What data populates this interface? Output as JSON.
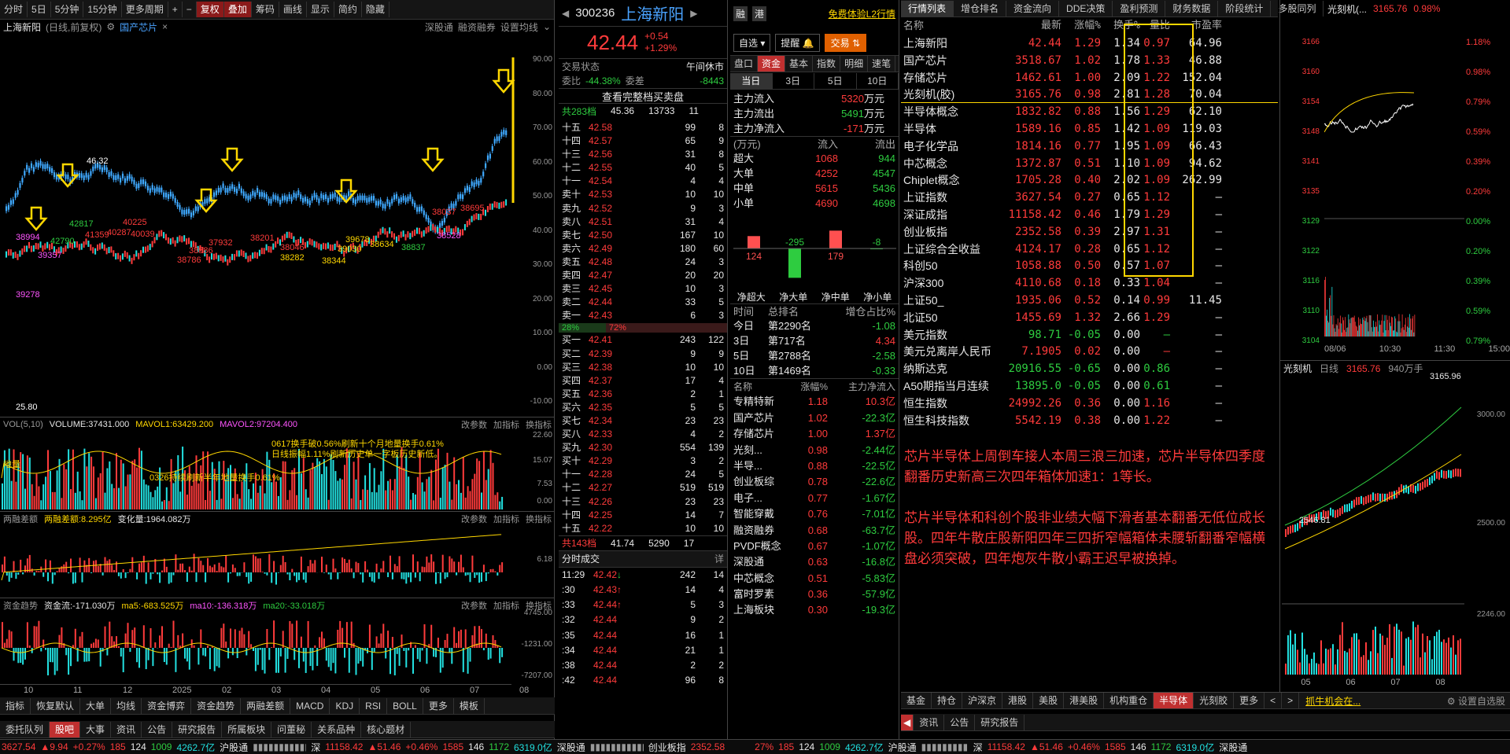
{
  "toolbar": {
    "buttons": [
      "分时",
      "5日",
      "5分钟",
      "15分钟",
      "更多周期",
      "复权",
      "叠加",
      "筹码",
      "画线",
      "显示",
      "简约",
      "隐藏"
    ]
  },
  "chart": {
    "title": "上海新阳",
    "subtitle": "(日线,前复权)",
    "overlay": "国产芯片",
    "links": [
      "深股通",
      "融资融券",
      "设置均线"
    ],
    "price_axis": [
      "90.00",
      "80.00",
      "70.00",
      "60.00",
      "50.00",
      "40.00",
      "30.00",
      "20.00",
      "10.00",
      "0.00",
      "-10.00"
    ],
    "date_axis": [
      "10",
      "11",
      "12",
      "2025",
      "02",
      "03",
      "04",
      "05",
      "06",
      "07",
      "08"
    ],
    "peak_label": "46.32",
    "low_label": "25.80",
    "overlay_labels": [
      {
        "t": "38994",
        "c": "mag"
      },
      {
        "t": "39357",
        "c": "mag"
      },
      {
        "t": "42790",
        "c": "grn"
      },
      {
        "t": "42817",
        "c": "grn"
      },
      {
        "t": "41359",
        "c": "red"
      },
      {
        "t": "40287",
        "c": "red"
      },
      {
        "t": "40225",
        "c": "red"
      },
      {
        "t": "40039",
        "c": "red"
      },
      {
        "t": "38786",
        "c": "red"
      },
      {
        "t": "38586",
        "c": "red"
      },
      {
        "t": "37932",
        "c": "red"
      },
      {
        "t": "38201",
        "c": "red"
      },
      {
        "t": "38046",
        "c": "red"
      },
      {
        "t": "38282",
        "c": "yel"
      },
      {
        "t": "38344",
        "c": "yel"
      },
      {
        "t": "39030",
        "c": "yel"
      },
      {
        "t": "39678",
        "c": "yel"
      },
      {
        "t": "38634",
        "c": "yel"
      },
      {
        "t": "38837",
        "c": "grn"
      },
      {
        "t": "38037",
        "c": "red"
      },
      {
        "t": "38695",
        "c": "red"
      },
      {
        "t": "38528",
        "c": "mag"
      },
      {
        "t": "39278",
        "c": "mag"
      }
    ]
  },
  "vol": {
    "header": "VOL(5,10)",
    "volume": "VOLUME:37431.000",
    "ma1": "MAVOL1:63429.200",
    "ma2": "MAVOL2:97204.400",
    "actions": [
      "改参数",
      "加指标",
      "换指标"
    ],
    "axis": [
      "22.60",
      "15.07",
      "7.53",
      "0.00"
    ],
    "note1": "0617换手破0.56%刷新十个月地量换手0.61%",
    "note2": "日线振幅1.11%刷新历史单一字板历史新低。",
    "note3": "0326持续刷新半年地量换手0.61%",
    "note4": "地量"
  },
  "margin": {
    "header": "两融差额",
    "value": "两融差额:8.295亿",
    "change": "变化量:1964.082万",
    "actions": [
      "改参数",
      "加指标",
      "换指标"
    ],
    "axis": [
      "6.18"
    ]
  },
  "flow": {
    "header": "资金趋势",
    "value": "资金流:-171.030万",
    "ma5": "ma5:-683.525万",
    "ma10": "ma10:-136.318万",
    "ma20": "ma20:-33.018万",
    "actions": [
      "改参数",
      "加指标",
      "换指标"
    ],
    "axis": [
      "4745.00",
      "-1231.00",
      "-7207.00"
    ]
  },
  "indicator_tabs": [
    "指标",
    "恢复默认",
    "大单",
    "均线",
    "资金博弈",
    "资金趋势",
    "两融差额",
    "MACD",
    "KDJ",
    "RSI",
    "BOLL",
    "更多",
    "模板"
  ],
  "bottom_left_tabs": [
    "委托队列",
    "股吧",
    "大事",
    "资讯",
    "公告",
    "研究报告",
    "所属板块",
    "问董秘",
    "关系品种",
    "核心题材"
  ],
  "status": {
    "sh_index": "3627.54",
    "sh_change": "9.94",
    "sh_pct": "+0.27%",
    "sh_up": "185",
    "sh_flat": "124",
    "sh_down": "1009",
    "sh_amt": "4262.7亿",
    "sh_conn": "沪股通",
    "sz_label": "深",
    "sz_index": "11158.42",
    "sz_change": "51.46",
    "sz_pct": "+0.46%",
    "sz_up": "1585",
    "sz_flat": "146",
    "sz_down": "1172",
    "sz_amt": "6319.0亿",
    "sz_conn": "深股通",
    "cy_label": "创业板指",
    "cy_index": "2352.58",
    "r_pct": "27%",
    "r_up": "185",
    "r_flat": "124",
    "r_down": "1009",
    "r_amt": "4262.7亿",
    "r_conn": "沪股通",
    "r_sz": "深",
    "r_szidx": "11158.42",
    "r_szchg": "51.46",
    "r_szpct": "+0.46%",
    "r_szup": "1585",
    "r_szflat": "146",
    "r_szdown": "1172",
    "r_szamt": "6319.0亿",
    "r_szconn": "深股通"
  },
  "stock": {
    "code": "300236",
    "name": "上海新阳",
    "tags": [
      "融",
      "港"
    ],
    "l2": "免费体验L2行情",
    "price": "42.44",
    "change": "+0.54",
    "pct": "+1.29%",
    "select_btn": "自选",
    "alert_btn": "提醒",
    "trade_btn": "交易",
    "trade_status_label": "交易状态",
    "trade_status": "午间休市",
    "wb_label": "委比",
    "wb": "-44.38%",
    "wc_label": "委差",
    "wc": "-8443",
    "full_book": "查看完整档买卖盘",
    "total_sell": "共283档",
    "total_sell_p": "45.36",
    "total_sell_v": "13733",
    "total_sell_n": "11",
    "sell_pct": "28%",
    "buy_pct": "72%",
    "total_buy": "共143档",
    "total_buy_p": "41.74",
    "total_buy_v": "5290",
    "total_buy_n": "17"
  },
  "sells": [
    {
      "l": "十五",
      "p": "42.58",
      "v": "99",
      "n": "8"
    },
    {
      "l": "十四",
      "p": "42.57",
      "v": "65",
      "n": "9"
    },
    {
      "l": "十三",
      "p": "42.56",
      "v": "31",
      "n": "8"
    },
    {
      "l": "十二",
      "p": "42.55",
      "v": "40",
      "n": "5"
    },
    {
      "l": "十一",
      "p": "42.54",
      "v": "4",
      "n": "4"
    },
    {
      "l": "卖十",
      "p": "42.53",
      "v": "10",
      "n": "10"
    },
    {
      "l": "卖九",
      "p": "42.52",
      "v": "9",
      "n": "3"
    },
    {
      "l": "卖八",
      "p": "42.51",
      "v": "31",
      "n": "4"
    },
    {
      "l": "卖七",
      "p": "42.50",
      "v": "167",
      "n": "10"
    },
    {
      "l": "卖六",
      "p": "42.49",
      "v": "180",
      "n": "60"
    },
    {
      "l": "卖五",
      "p": "42.48",
      "v": "24",
      "n": "3"
    },
    {
      "l": "卖四",
      "p": "42.47",
      "v": "20",
      "n": "20"
    },
    {
      "l": "卖三",
      "p": "42.45",
      "v": "10",
      "n": "3"
    },
    {
      "l": "卖二",
      "p": "42.44",
      "v": "33",
      "n": "5"
    },
    {
      "l": "卖一",
      "p": "42.43",
      "v": "6",
      "n": "3"
    }
  ],
  "buys": [
    {
      "l": "买一",
      "p": "42.41",
      "v": "243",
      "n": "122"
    },
    {
      "l": "买二",
      "p": "42.39",
      "v": "9",
      "n": "9"
    },
    {
      "l": "买三",
      "p": "42.38",
      "v": "10",
      "n": "10"
    },
    {
      "l": "买四",
      "p": "42.37",
      "v": "17",
      "n": "4"
    },
    {
      "l": "买五",
      "p": "42.36",
      "v": "2",
      "n": "1"
    },
    {
      "l": "买六",
      "p": "42.35",
      "v": "5",
      "n": "5"
    },
    {
      "l": "买七",
      "p": "42.34",
      "v": "23",
      "n": "23"
    },
    {
      "l": "买八",
      "p": "42.33",
      "v": "4",
      "n": "2"
    },
    {
      "l": "买九",
      "p": "42.30",
      "v": "554",
      "n": "139"
    },
    {
      "l": "买十",
      "p": "42.29",
      "v": "3",
      "n": "2"
    },
    {
      "l": "十一",
      "p": "42.28",
      "v": "24",
      "n": "5"
    },
    {
      "l": "十二",
      "p": "42.27",
      "v": "519",
      "n": "519"
    },
    {
      "l": "十三",
      "p": "42.26",
      "v": "23",
      "n": "23"
    },
    {
      "l": "十四",
      "p": "42.25",
      "v": "14",
      "n": "7"
    },
    {
      "l": "十五",
      "p": "42.22",
      "v": "10",
      "n": "10"
    }
  ],
  "ticks_header": "分时成交",
  "ticks_detail": "详",
  "ticks": [
    {
      "t": "11:29",
      "p": "42.42",
      "a": "↓",
      "v": "242",
      "n": "14"
    },
    {
      "t": ":30",
      "p": "42.43",
      "a": "↑",
      "v": "14",
      "n": "4"
    },
    {
      "t": ":33",
      "p": "42.44",
      "a": "↑",
      "v": "5",
      "n": "3"
    },
    {
      "t": ":32",
      "p": "42.44",
      "a": "",
      "v": "9",
      "n": "2"
    },
    {
      "t": ":35",
      "p": "42.44",
      "a": "",
      "v": "16",
      "n": "1"
    },
    {
      "t": ":34",
      "p": "42.44",
      "a": "",
      "v": "21",
      "n": "1"
    },
    {
      "t": ":38",
      "p": "42.44",
      "a": "",
      "v": "2",
      "n": "2"
    },
    {
      "t": ":42",
      "p": "42.44",
      "a": "",
      "v": "96",
      "n": "8"
    }
  ],
  "fund_tabs": [
    "盘口",
    "资金",
    "基本",
    "指数",
    "明细",
    "速笔"
  ],
  "fund_periods": [
    "当日",
    "3日",
    "5日",
    "10日"
  ],
  "fund_main": [
    {
      "k": "主力流入",
      "v": "5320",
      "u": "万元"
    },
    {
      "k": "主力流出",
      "v": "5491",
      "u": "万元"
    },
    {
      "k": "主力净流入",
      "v": "-171",
      "u": "万元"
    }
  ],
  "fund_head": [
    "(万元)",
    "流入",
    "流出"
  ],
  "fund_rows": [
    {
      "k": "超大",
      "i": "1068",
      "o": "944"
    },
    {
      "k": "大单",
      "i": "4252",
      "o": "4547"
    },
    {
      "k": "中单",
      "i": "5615",
      "o": "5436"
    },
    {
      "k": "小单",
      "i": "4690",
      "o": "4698"
    }
  ],
  "fund_bars": {
    "values": [
      124,
      -295,
      179,
      -8
    ],
    "labels": [
      "124",
      "-295",
      "179",
      "-8"
    ],
    "names": [
      "净超大",
      "净大单",
      "净中单",
      "净小单"
    ]
  },
  "rank_head": [
    "时间",
    "总排名",
    "增仓占比%"
  ],
  "rank_rows": [
    {
      "t": "今日",
      "r": "第2290名",
      "p": "-1.08"
    },
    {
      "t": "3日",
      "r": "第717名",
      "p": "4.34"
    },
    {
      "t": "5日",
      "r": "第2788名",
      "p": "-2.58"
    },
    {
      "t": "10日",
      "r": "第1469名",
      "p": "-0.33"
    }
  ],
  "sector_head": [
    "名称",
    "涨幅%",
    "主力净流入"
  ],
  "sectors": [
    {
      "n": "专精特新",
      "p": "1.18",
      "f": "10.3亿"
    },
    {
      "n": "国产芯片",
      "p": "1.02",
      "f": "-22.3亿"
    },
    {
      "n": "存储芯片",
      "p": "1.00",
      "f": "1.37亿"
    },
    {
      "n": "光刻...",
      "p": "0.98",
      "f": "-2.44亿"
    },
    {
      "n": "半导...",
      "p": "0.88",
      "f": "-22.5亿"
    },
    {
      "n": "创业板综",
      "p": "0.78",
      "f": "-22.6亿"
    },
    {
      "n": "电子...",
      "p": "0.77",
      "f": "-1.67亿"
    },
    {
      "n": "智能穿戴",
      "p": "0.76",
      "f": "-7.01亿"
    },
    {
      "n": "融资融券",
      "p": "0.68",
      "f": "-63.7亿"
    },
    {
      "n": "PVDF概念",
      "p": "0.67",
      "f": "-1.07亿"
    },
    {
      "n": "深股通",
      "p": "0.63",
      "f": "-16.8亿"
    },
    {
      "n": "中芯概念",
      "p": "0.51",
      "f": "-5.83亿"
    },
    {
      "n": "富时罗素",
      "p": "0.36",
      "f": "-57.9亿"
    },
    {
      "n": "上海板块",
      "p": "0.30",
      "f": "-19.3亿"
    }
  ],
  "quote_tabs": [
    "行情列表",
    "增仓排名",
    "资金流向",
    "DDE决策",
    "盈利预测",
    "财务数据",
    "阶段统计",
    "多股同列"
  ],
  "quote_head": [
    "名称",
    "最新",
    "涨幅%",
    "换手%",
    "量比",
    "市盈率"
  ],
  "quotes": [
    {
      "n": "上海新阳",
      "p": "42.44",
      "c": "1.29",
      "h": "1.34",
      "v": "0.97",
      "e": "64.96",
      "cl": "red"
    },
    {
      "n": "国产芯片",
      "p": "3518.67",
      "c": "1.02",
      "h": "1.78",
      "v": "1.33",
      "e": "46.88",
      "cl": "red"
    },
    {
      "n": "存储芯片",
      "p": "1462.61",
      "c": "1.00",
      "h": "2.09",
      "v": "1.22",
      "e": "152.04",
      "cl": "red"
    },
    {
      "n": "光刻机(胶)",
      "p": "3165.76",
      "c": "0.98",
      "h": "2.81",
      "v": "1.28",
      "e": "70.04",
      "cl": "red"
    },
    {
      "n": "半导体概念",
      "p": "1832.82",
      "c": "0.88",
      "h": "1.56",
      "v": "1.29",
      "e": "62.10",
      "cl": "red"
    },
    {
      "n": "半导体",
      "p": "1589.16",
      "c": "0.85",
      "h": "1.42",
      "v": "1.09",
      "e": "119.03",
      "cl": "red"
    },
    {
      "n": "电子化学品",
      "p": "1814.16",
      "c": "0.77",
      "h": "1.95",
      "v": "1.09",
      "e": "66.43",
      "cl": "red"
    },
    {
      "n": "中芯概念",
      "p": "1372.87",
      "c": "0.51",
      "h": "1.10",
      "v": "1.09",
      "e": "94.62",
      "cl": "red"
    },
    {
      "n": "Chiplet概念",
      "p": "1705.28",
      "c": "0.40",
      "h": "2.02",
      "v": "1.09",
      "e": "262.99",
      "cl": "red"
    },
    {
      "n": "上证指数",
      "p": "3627.54",
      "c": "0.27",
      "h": "0.65",
      "v": "1.12",
      "e": "—",
      "cl": "red"
    },
    {
      "n": "深证成指",
      "p": "11158.42",
      "c": "0.46",
      "h": "1.79",
      "v": "1.29",
      "e": "—",
      "cl": "red"
    },
    {
      "n": "创业板指",
      "p": "2352.58",
      "c": "0.39",
      "h": "2.97",
      "v": "1.31",
      "e": "—",
      "cl": "red"
    },
    {
      "n": "上证综合全收益",
      "p": "4124.17",
      "c": "0.28",
      "h": "0.65",
      "v": "1.12",
      "e": "—",
      "cl": "red"
    },
    {
      "n": "科创50",
      "p": "1058.88",
      "c": "0.50",
      "h": "0.57",
      "v": "1.07",
      "e": "—",
      "cl": "red"
    },
    {
      "n": "沪深300",
      "p": "4110.68",
      "c": "0.18",
      "h": "0.33",
      "v": "1.04",
      "e": "—",
      "cl": "red"
    },
    {
      "n": "上证50_",
      "p": "1935.06",
      "c": "0.52",
      "h": "0.14",
      "v": "0.99",
      "e": "11.45",
      "cl": "red"
    },
    {
      "n": "北证50",
      "p": "1455.69",
      "c": "1.32",
      "h": "2.66",
      "v": "1.29",
      "e": "—",
      "cl": "red"
    },
    {
      "n": "美元指数",
      "p": "98.71",
      "c": "-0.05",
      "h": "0.00",
      "v": "—",
      "e": "—",
      "cl": "grn"
    },
    {
      "n": "美元兑离岸人民币",
      "p": "7.1905",
      "c": "0.02",
      "h": "0.00",
      "v": "—",
      "e": "—",
      "cl": "red"
    },
    {
      "n": "纳斯达克",
      "p": "20916.55",
      "c": "-0.65",
      "h": "0.00",
      "v": "0.86",
      "e": "—",
      "cl": "grn"
    },
    {
      "n": "A50期指当月连续",
      "p": "13895.0",
      "c": "-0.05",
      "h": "0.00",
      "v": "0.61",
      "e": "—",
      "cl": "grn"
    },
    {
      "n": "恒生指数",
      "p": "24992.26",
      "c": "0.36",
      "h": "0.00",
      "v": "1.16",
      "e": "—",
      "cl": "red"
    },
    {
      "n": "恒生科技指数",
      "p": "5542.19",
      "c": "0.38",
      "h": "0.00",
      "v": "1.22",
      "e": "—",
      "cl": "red"
    }
  ],
  "note": {
    "p1": "芯片半导体上周倒车接人本周三浪三加速，芯片半导体四季度翻番历史新高三次四年箱体加速1：1等长。",
    "p2": "芯片半导体和科创个股非业绩大幅下滑者基本翻番无低位成长股。四年牛散庄股新阳四年三四折窄幅箱体未腰斩翻番窄幅横盘必须突破，四年炮灰牛散小霸王迟早被换掉。"
  },
  "mini": {
    "title": "光刻机(...",
    "price": "3165.76",
    "pct": "0.98%",
    "axis_l": [
      "3166",
      "3160",
      "3154",
      "3148",
      "3141",
      "3135",
      "3129",
      "3122",
      "3116",
      "3110",
      "3104"
    ],
    "axis_r": [
      "1.18%",
      "0.98%",
      "0.79%",
      "0.59%",
      "0.39%",
      "0.20%",
      "0.00%",
      "0.20%",
      "0.39%",
      "0.59%",
      "0.79%"
    ],
    "times": [
      "08/06",
      "10:30",
      "11:30",
      "15:00"
    ]
  },
  "kmini": {
    "title": "光刻机",
    "period": "日线",
    "price": "3165.76",
    "vol": "940万手",
    "hi": "3165.96",
    "lo": "2546.81",
    "axis": [
      "3000.00",
      "2500.00",
      "2246.00"
    ],
    "dates": [
      "05",
      "06",
      "07",
      "08"
    ]
  },
  "sector_tabs": [
    "基金",
    "持仓",
    "沪深京",
    "港股",
    "美股",
    "港美股",
    "机构重仓",
    "半导体",
    "光刻胶",
    "更多"
  ],
  "bottom_right_tabs": [
    "资讯",
    "公告",
    "研究报告"
  ],
  "ticker_news": "抓牛机会在...",
  "settings": "设置自选股"
}
